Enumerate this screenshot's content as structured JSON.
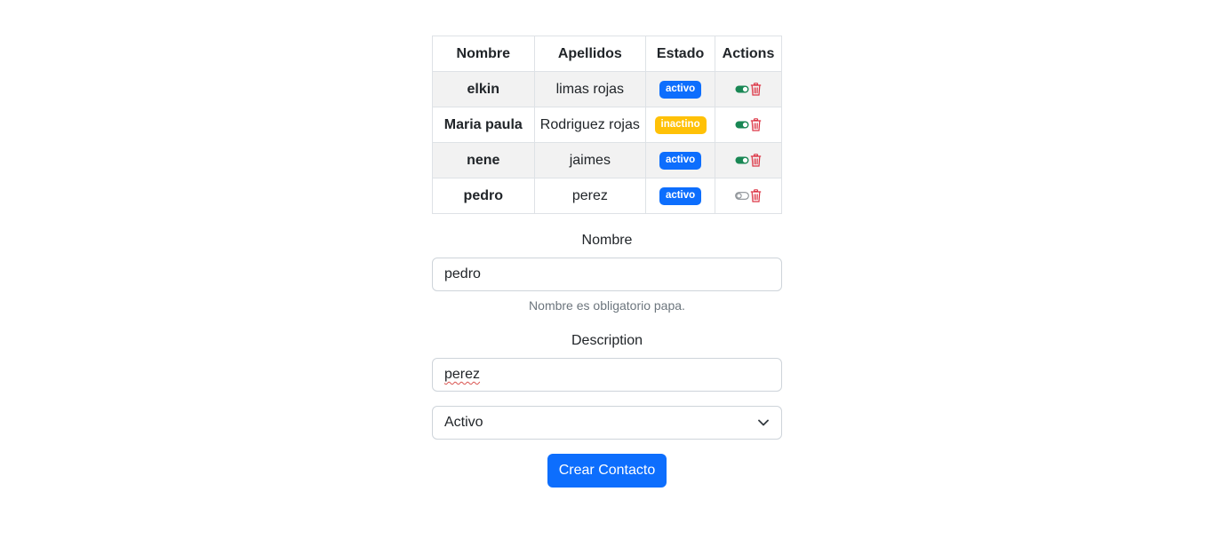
{
  "table": {
    "headers": [
      "Nombre",
      "Apellidos",
      "Estado",
      "Actions"
    ],
    "rows": [
      {
        "nombre": "elkin",
        "apellidos": "limas rojas",
        "estado": "activo",
        "estado_color": "#0d6efd",
        "toggle_on": true
      },
      {
        "nombre": "Maria paula",
        "apellidos": "Rodriguez rojas",
        "estado": "inactino",
        "estado_color": "#ffc107",
        "toggle_on": true
      },
      {
        "nombre": "nene",
        "apellidos": "jaimes",
        "estado": "activo",
        "estado_color": "#0d6efd",
        "toggle_on": true
      },
      {
        "nombre": "pedro",
        "apellidos": "perez",
        "estado": "activo",
        "estado_color": "#0d6efd",
        "toggle_on": false
      }
    ],
    "action_icons": [
      "toggle-icon",
      "trash-icon"
    ]
  },
  "form": {
    "nombre_label": "Nombre",
    "nombre_value": "pedro",
    "nombre_help": "Nombre es obligatorio papa.",
    "description_label": "Description",
    "description_value": "perez",
    "estado_select_value": "Activo",
    "submit_label": "Crear Contacto"
  },
  "colors": {
    "primary": "#0d6efd",
    "warning": "#ffc107",
    "toggle_on": "#198754",
    "trash": "#dc3545"
  }
}
